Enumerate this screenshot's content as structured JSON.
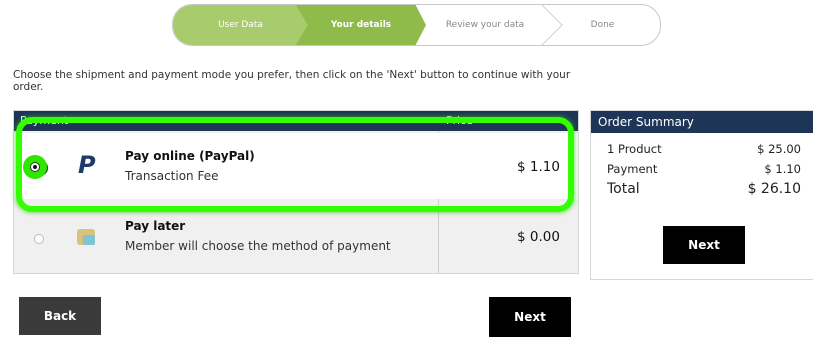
{
  "steps": [
    {
      "label": "User Data",
      "state": "done"
    },
    {
      "label": "Your details",
      "state": "current"
    },
    {
      "label": "Review your data",
      "state": "todo"
    },
    {
      "label": "Done",
      "state": "todo"
    }
  ],
  "intro": "Choose the shipment and payment mode you prefer, then click on the 'Next' button to continue with your order.",
  "payment_table": {
    "header_payment": "Payment",
    "header_price": "Price",
    "options": [
      {
        "title": "Pay online (PayPal)",
        "subtitle": "Transaction Fee",
        "price": "$ 1.10",
        "icon": "paypal-icon",
        "selected": true
      },
      {
        "title": "Pay later",
        "subtitle": "Member will choose the method of payment",
        "price": "$ 0.00",
        "icon": "pay-later-icon",
        "selected": false
      }
    ]
  },
  "summary": {
    "title": "Order Summary",
    "rows": [
      {
        "label": "1 Product",
        "value": "$ 25.00"
      },
      {
        "label": "Payment",
        "value": "$ 1.10"
      },
      {
        "label": "Total",
        "value": "$ 26.10"
      }
    ],
    "next_label": "Next"
  },
  "buttons": {
    "back": "Back",
    "next": "Next"
  },
  "colors": {
    "header": "#1f3557",
    "step_done": "#a8cc6d",
    "step_current": "#8fbb4a",
    "highlight": "#33ff00"
  }
}
